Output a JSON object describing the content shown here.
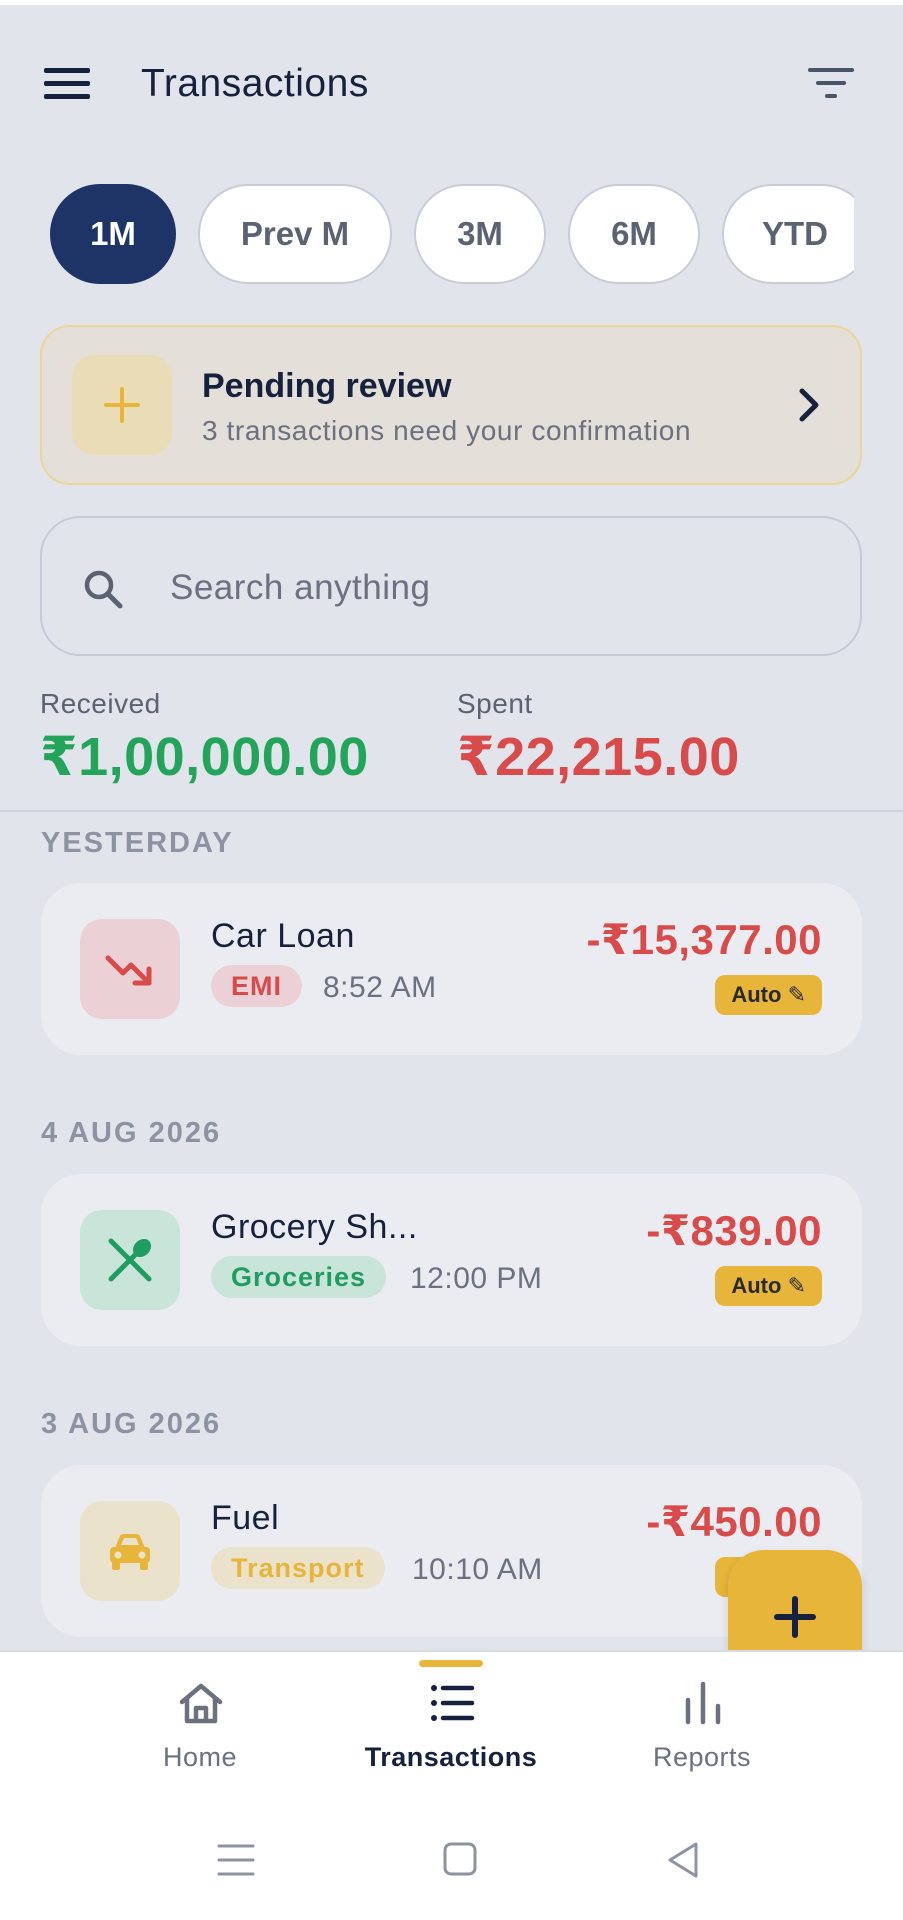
{
  "header": {
    "title": "Transactions",
    "menu_icon": "hamburger-menu-icon",
    "filter_icon": "filter-icon"
  },
  "periods": [
    {
      "label": "1M",
      "active": true
    },
    {
      "label": "Prev M",
      "active": false
    },
    {
      "label": "3M",
      "active": false
    },
    {
      "label": "6M",
      "active": false
    },
    {
      "label": "YTD",
      "active": false
    }
  ],
  "pending": {
    "title": "Pending review",
    "subtitle": "3 transactions need your confirmation",
    "icon": "plus-icon"
  },
  "search": {
    "placeholder": "Search anything",
    "value": ""
  },
  "summary": {
    "received_label": "Received",
    "received_value": "₹1,00,000.00",
    "spent_label": "Spent",
    "spent_value": "₹22,215.00"
  },
  "groups": [
    {
      "date": "YESTERDAY",
      "items": [
        {
          "name": "Car Loan",
          "tag": "EMI",
          "time": "8:52 AM",
          "amount": "-₹15,377.00",
          "badge": "Auto ✎",
          "icon": "trending-down-icon"
        }
      ]
    },
    {
      "date": "4 AUG 2026",
      "items": [
        {
          "name": "Grocery Sh...",
          "tag": "Groceries",
          "time": "12:00 PM",
          "amount": "-₹839.00",
          "badge": "Auto ✎",
          "icon": "utensils-icon"
        }
      ]
    },
    {
      "date": "3 AUG 2026",
      "items": [
        {
          "name": "Fuel",
          "tag": "Transport",
          "time": "10:10 AM",
          "amount": "-₹450.00",
          "badge": "Auto ✎",
          "icon": "car-icon"
        }
      ]
    }
  ],
  "nav": [
    {
      "label": "Home",
      "icon": "home-icon",
      "active": false
    },
    {
      "label": "Transactions",
      "icon": "list-icon",
      "active": true
    },
    {
      "label": "Reports",
      "icon": "bar-chart-icon",
      "active": false
    }
  ],
  "colors": {
    "primary": "#1f3466",
    "accent": "#e6b53a",
    "received": "#22a55a",
    "spent": "#d94b4b",
    "background": "#e2e4ec"
  }
}
